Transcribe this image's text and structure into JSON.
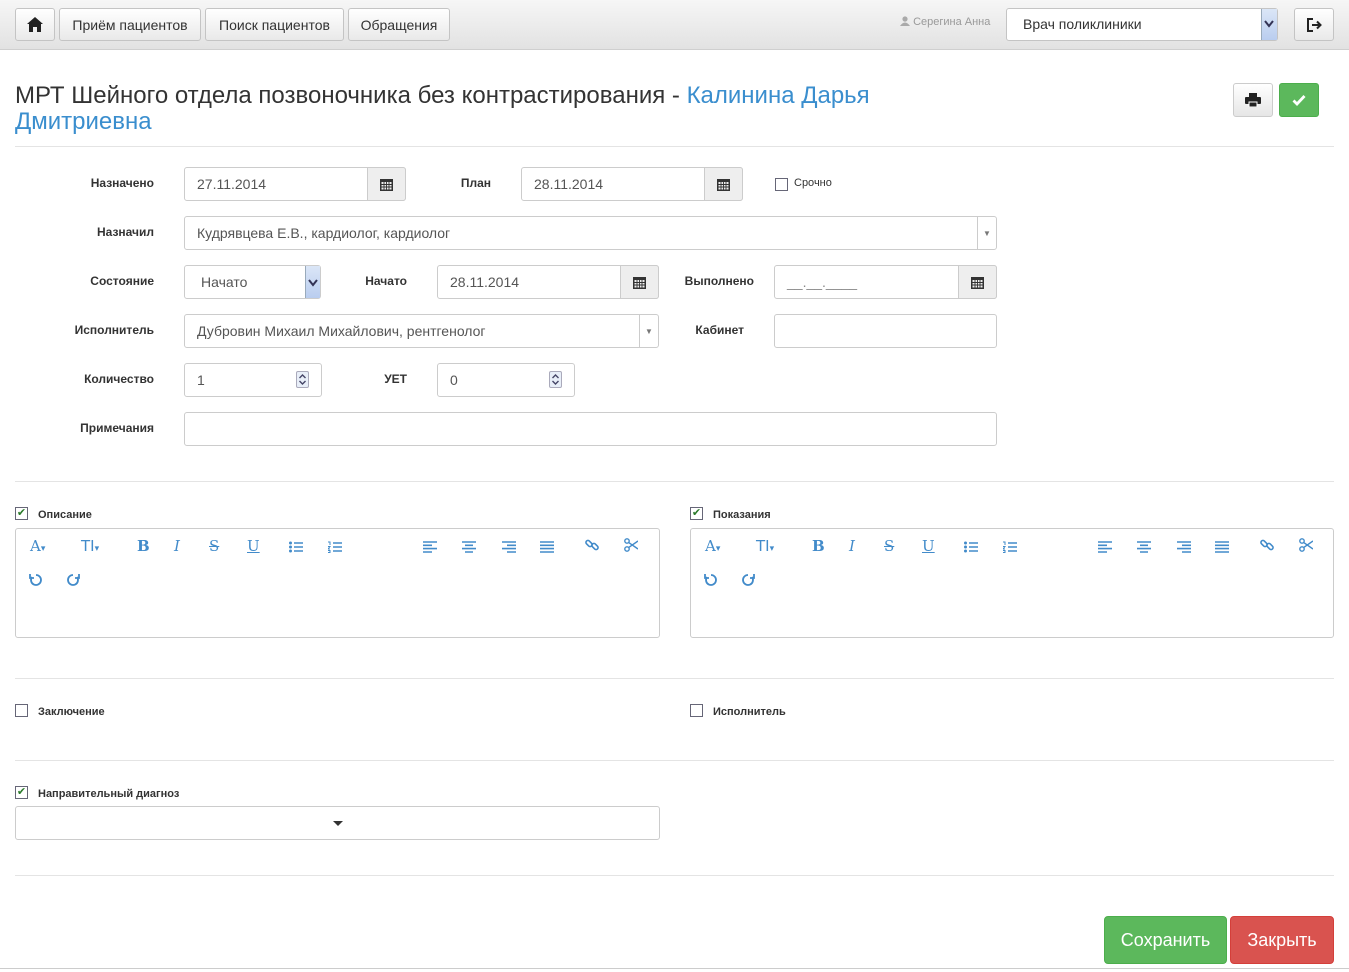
{
  "nav": {
    "buttons": [
      "Приём пациентов",
      "Поиск пациентов",
      "Обращения"
    ],
    "user": "Серегина Анна",
    "role": "Врач поликлиники"
  },
  "header": {
    "title": "МРТ Шейного отдела позвоночника без контрастирования - ",
    "patient": "Калинина Дарья Дмитриевна"
  },
  "form": {
    "assigned_label": "Назначено",
    "assigned_value": "27.11.2014",
    "plan_label": "План",
    "plan_value": "28.11.2014",
    "urgent_label": "Срочно",
    "assigned_by_label": "Назначил",
    "assigned_by_value": "Кудрявцева Е.В., кардиолог, кардиолог",
    "state_label": "Состояние",
    "state_value": "Начато",
    "started_label": "Начато",
    "started_value": "28.11.2014",
    "done_label": "Выполнено",
    "done_value": "__.__.____",
    "performer_label": "Исполнитель",
    "performer_value": "Дубровин Михаил Михайлович, рентгенолог",
    "cabinet_label": "Кабинет",
    "cabinet_value": "",
    "quantity_label": "Количество",
    "quantity_value": "1",
    "uet_label": "УЕТ",
    "uet_value": "0",
    "notes_label": "Примечания",
    "notes_value": ""
  },
  "sections": {
    "description": "Описание",
    "indications": "Показания",
    "conclusion": "Заключение",
    "performer": "Исполнитель",
    "referral_diagnosis": "Направительный диагноз"
  },
  "toolbar": {
    "font": "A",
    "size": "TI",
    "bold": "B",
    "italic": "I",
    "strike": "S",
    "underline": "U"
  },
  "actions": {
    "save": "Сохранить",
    "close": "Закрыть"
  },
  "colors": {
    "accent": "#428bca",
    "success": "#5cb85c",
    "danger": "#d9534f"
  }
}
